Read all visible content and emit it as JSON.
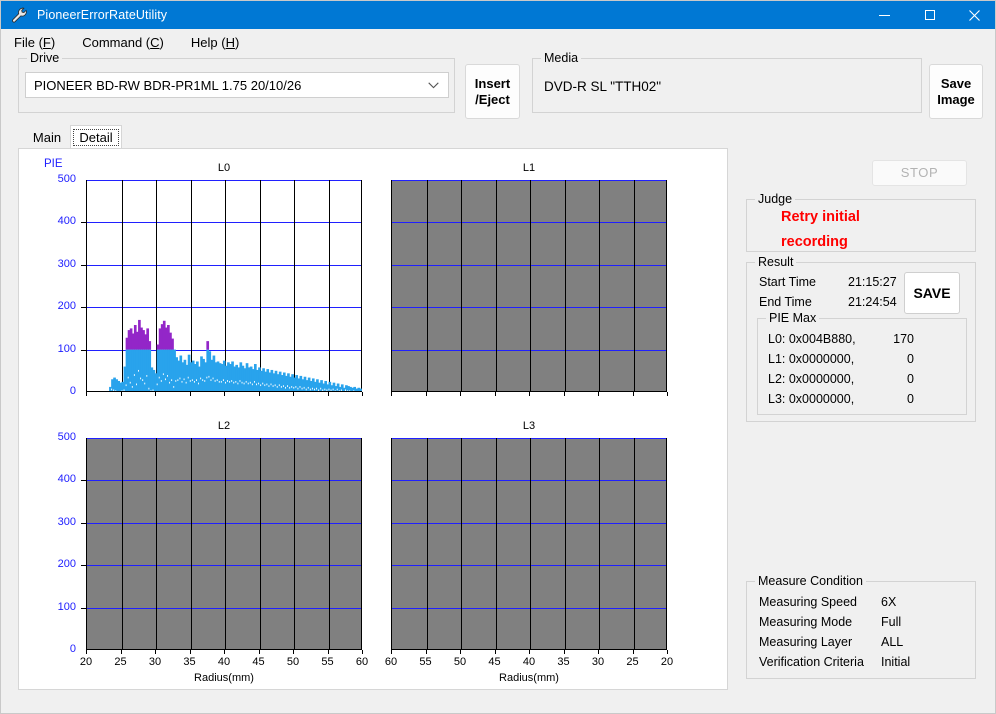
{
  "window": {
    "title": "PioneerErrorRateUtility",
    "icon": "wrench-icon",
    "minimize": "—",
    "maximize": "□",
    "close": "✕",
    "accent": "#0078d4"
  },
  "menu": [
    {
      "label": "File",
      "accel": "F"
    },
    {
      "label": "Command",
      "accel": "C"
    },
    {
      "label": "Help",
      "accel": "H"
    }
  ],
  "drive": {
    "group_label": "Drive",
    "selected": "PIONEER BD-RW  BDR-PR1ML 1.75 20/10/26",
    "caret": "⌄"
  },
  "media": {
    "group_label": "Media",
    "value": "DVD-R SL \"TTH02\""
  },
  "buttons": {
    "insert_eject_line1": "Insert",
    "insert_eject_line2": "/Eject",
    "save_image_line1": "Save",
    "save_image_line2": "Image",
    "stop": "STOP",
    "save": "SAVE"
  },
  "tabs": [
    {
      "label": "Main",
      "active": false
    },
    {
      "label": "Detail",
      "active": true
    }
  ],
  "judge": {
    "group_label": "Judge",
    "line1": "Retry initial",
    "line2": "recording",
    "color": "#ff0000"
  },
  "result": {
    "group_label": "Result",
    "start_time_label": "Start Time",
    "start_time_value": "21:15:27",
    "end_time_label": "End Time",
    "end_time_value": "21:24:54",
    "pie_max_label": "PIE Max",
    "pie_max_rows": [
      {
        "layer": "L0:",
        "address": "0x004B880,",
        "value": "170"
      },
      {
        "layer": "L1:",
        "address": "0x0000000,",
        "value": "0"
      },
      {
        "layer": "L2:",
        "address": "0x0000000,",
        "value": "0"
      },
      {
        "layer": "L3:",
        "address": "0x0000000,",
        "value": "0"
      }
    ]
  },
  "measure_condition": {
    "group_label": "Measure Condition",
    "rows": [
      {
        "label": "Measuring Speed",
        "value": "6X"
      },
      {
        "label": "Measuring Mode",
        "value": "Full"
      },
      {
        "label": "Measuring Layer",
        "value": "ALL"
      },
      {
        "label": "Verification Criteria",
        "value": "Initial"
      }
    ]
  },
  "chart_data": [
    {
      "id": "L0",
      "type": "area",
      "title": "L0",
      "xlabel": "Radius(mm)",
      "ylabel": "PIE",
      "xlim": [
        20,
        60
      ],
      "ylim": [
        0,
        500
      ],
      "xticks": [
        20,
        25,
        30,
        35,
        40,
        45,
        50,
        55,
        60
      ],
      "yticks": [
        0,
        100,
        200,
        300,
        400,
        500
      ],
      "grid": true,
      "enabled": true,
      "axis_reversed": false,
      "series": [
        {
          "name": "PIE below threshold",
          "color": "#29a3ec"
        },
        {
          "name": "PIE above threshold",
          "color": "#9326c8"
        }
      ],
      "threshold": 100,
      "x": [
        23.2,
        23.5,
        23.8,
        24.1,
        24.4,
        24.7,
        25.0,
        25.3,
        25.6,
        25.9,
        26.2,
        26.5,
        26.8,
        27.1,
        27.4,
        27.7,
        28.0,
        28.3,
        28.6,
        28.9,
        29.2,
        29.5,
        29.8,
        30.1,
        30.4,
        30.7,
        31.0,
        31.3,
        31.6,
        31.9,
        32.2,
        32.5,
        32.8,
        33.1,
        33.4,
        33.7,
        34.0,
        34.3,
        34.6,
        34.9,
        35.2,
        35.5,
        35.8,
        36.1,
        36.4,
        36.7,
        37.0,
        37.3,
        37.6,
        37.9,
        38.2,
        38.5,
        38.8,
        39.1,
        39.4,
        39.7,
        40.0,
        40.3,
        40.6,
        40.9,
        41.2,
        41.5,
        41.8,
        42.1,
        42.4,
        42.7,
        43.0,
        43.3,
        43.6,
        43.9,
        44.2,
        44.5,
        44.8,
        45.1,
        45.4,
        45.7,
        46.0,
        46.3,
        46.6,
        46.9,
        47.2,
        47.5,
        47.8,
        48.1,
        48.4,
        48.7,
        49.0,
        49.3,
        49.6,
        49.9,
        50.2,
        50.5,
        50.8,
        51.1,
        51.4,
        51.7,
        52.0,
        52.3,
        52.6,
        52.9,
        53.2,
        53.5,
        53.8,
        54.1,
        54.4,
        54.7,
        55.0,
        55.3,
        55.6,
        55.9,
        56.2,
        56.5,
        56.8,
        57.1,
        57.4,
        57.7,
        58.0,
        58.3,
        58.6,
        58.9,
        59.2,
        59.5,
        59.8
      ],
      "peak_values": [
        12,
        30,
        34,
        30,
        26,
        22,
        24,
        60,
        128,
        146,
        150,
        138,
        158,
        142,
        170,
        152,
        146,
        136,
        150,
        120,
        58,
        52,
        44,
        112,
        150,
        160,
        168,
        152,
        158,
        140,
        126,
        100,
        82,
        74,
        86,
        70,
        76,
        64,
        88,
        70,
        74,
        66,
        72,
        60,
        84,
        78,
        70,
        120,
        96,
        76,
        86,
        70,
        72,
        68,
        66,
        74,
        62,
        70,
        66,
        72,
        60,
        64,
        58,
        70,
        62,
        56,
        68,
        58,
        60,
        54,
        66,
        52,
        58,
        50,
        56,
        48,
        54,
        46,
        52,
        44,
        50,
        42,
        48,
        40,
        46,
        38,
        44,
        36,
        42,
        34,
        40,
        32,
        38,
        30,
        36,
        28,
        34,
        26,
        32,
        24,
        30,
        22,
        28,
        20,
        26,
        18,
        24,
        16,
        22,
        14,
        20,
        12,
        18,
        10,
        16,
        14,
        12,
        10,
        12,
        8,
        10,
        8,
        6
      ],
      "base_values": [
        2,
        8,
        6,
        4,
        3,
        2,
        4,
        6,
        18,
        36,
        24,
        14,
        42,
        20,
        52,
        34,
        30,
        22,
        40,
        10,
        4,
        6,
        3,
        20,
        36,
        28,
        44,
        32,
        40,
        24,
        30,
        14,
        28,
        30,
        34,
        26,
        32,
        24,
        36,
        28,
        30,
        26,
        30,
        22,
        34,
        30,
        28,
        36,
        38,
        30,
        34,
        28,
        30,
        26,
        26,
        30,
        24,
        28,
        26,
        28,
        24,
        26,
        22,
        28,
        24,
        22,
        26,
        22,
        24,
        20,
        26,
        20,
        22,
        18,
        22,
        18,
        20,
        16,
        20,
        16,
        18,
        14,
        18,
        14,
        16,
        12,
        16,
        12,
        14,
        12,
        14,
        10,
        14,
        10,
        12,
        8,
        12,
        8,
        10,
        8,
        10,
        6,
        10,
        6,
        8,
        6,
        8,
        6,
        8,
        4,
        8,
        4,
        6,
        4,
        6,
        4,
        4,
        4,
        4,
        2,
        4,
        2,
        2
      ]
    },
    {
      "id": "L1",
      "type": "area",
      "title": "L1",
      "xlabel": "Radius(mm)",
      "ylabel": "PIE",
      "xlim": [
        60,
        20
      ],
      "ylim": [
        0,
        500
      ],
      "xticks": [
        60,
        55,
        50,
        45,
        40,
        35,
        30,
        25,
        20
      ],
      "yticks": [
        0,
        100,
        200,
        300,
        400,
        500
      ],
      "grid": true,
      "enabled": false,
      "axis_reversed": true,
      "x": [],
      "peak_values": [],
      "base_values": []
    },
    {
      "id": "L2",
      "type": "area",
      "title": "L2",
      "xlabel": "Radius(mm)",
      "ylabel": "PIE",
      "xlim": [
        20,
        60
      ],
      "ylim": [
        0,
        500
      ],
      "xticks": [
        20,
        25,
        30,
        35,
        40,
        45,
        50,
        55,
        60
      ],
      "yticks": [
        0,
        100,
        200,
        300,
        400,
        500
      ],
      "grid": true,
      "enabled": false,
      "axis_reversed": false,
      "x": [],
      "peak_values": [],
      "base_values": []
    },
    {
      "id": "L3",
      "type": "area",
      "title": "L3",
      "xlabel": "Radius(mm)",
      "ylabel": "PIE",
      "xlim": [
        60,
        20
      ],
      "ylim": [
        0,
        500
      ],
      "xticks": [
        60,
        55,
        50,
        45,
        40,
        35,
        30,
        25,
        20
      ],
      "yticks": [
        0,
        100,
        200,
        300,
        400,
        500
      ],
      "grid": true,
      "enabled": false,
      "axis_reversed": true,
      "x": [],
      "peak_values": [],
      "base_values": []
    }
  ]
}
